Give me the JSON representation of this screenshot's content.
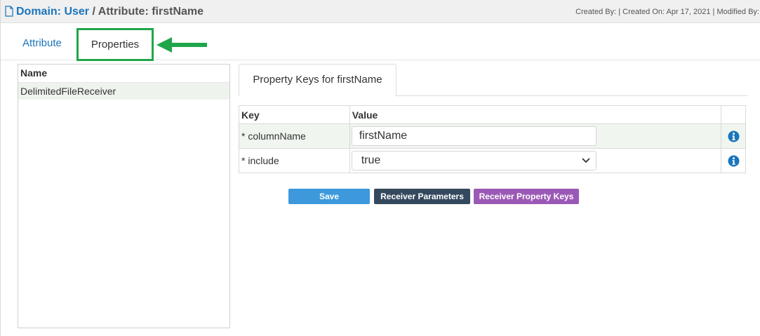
{
  "header": {
    "domain_label": "Domain: User",
    "separator": " / ",
    "attribute_label": "Attribute: firstName",
    "meta": "Created By: | Created On: Apr 17, 2021 | Modified By:"
  },
  "tabs": [
    {
      "label": "Attribute",
      "active": false
    },
    {
      "label": "Properties",
      "active": true
    }
  ],
  "left_panel": {
    "column_header": "Name",
    "items": [
      "DelimitedFileReceiver"
    ]
  },
  "sub_tab": {
    "label": "Property Keys for firstName"
  },
  "property_table": {
    "headers": [
      "Key",
      "Value"
    ],
    "rows": [
      {
        "key": "* columnName",
        "value": "firstName",
        "control": "text-input",
        "icon": "info-icon"
      },
      {
        "key": "* include",
        "value": "true",
        "control": "select",
        "icon": "info-icon"
      }
    ]
  },
  "buttons": {
    "save": "Save",
    "receiver_parameters": "Receiver Parameters",
    "receiver_property_keys": "Receiver Property Keys"
  },
  "colors": {
    "link_blue": "#1a75bb",
    "highlight_green": "#1fa64a",
    "save_button": "#3d99dc",
    "receiver_params_button": "#34495e",
    "receiver_keys_button": "#9b59b6",
    "info_icon": "#1a75bb"
  },
  "icons": {
    "header": "document-icon",
    "pointer": "arrow-left-icon",
    "dropdown": "chevron-down-icon",
    "info": "info-icon"
  }
}
